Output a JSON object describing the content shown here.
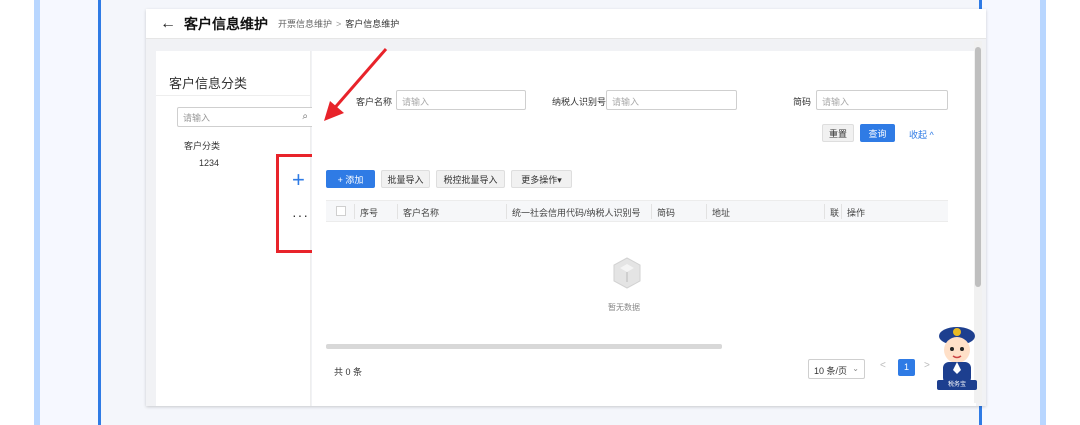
{
  "header": {
    "back_icon": "left-arrow-icon",
    "title": "客户信息维护",
    "breadcrumb": [
      "开票信息维护",
      "客户信息维护"
    ],
    "breadcrumb_sep": ">"
  },
  "left": {
    "title": "客户信息分类",
    "search_placeholder": "请输入",
    "tree": {
      "root": "客户分类",
      "child": "1234"
    },
    "annotation": {
      "plus": "+",
      "more": "···"
    }
  },
  "filters": {
    "customer_name_label": "客户名称",
    "customer_name_placeholder": "请输入",
    "tax_id_label": "纳税人识别号",
    "tax_id_placeholder": "请输入",
    "short_label": "简码",
    "short_placeholder": "请输入",
    "reset": "重置",
    "query": "查询",
    "collapse": "收起 ^"
  },
  "toolbar": {
    "add": "+ 添加",
    "batch_import": "批量导入",
    "tax_import": "税控批量导入",
    "more_actions": "更多操作▾"
  },
  "table": {
    "columns": [
      "序号",
      "客户名称",
      "统一社会信用代码/纳税人识别号",
      "简码",
      "地址",
      "联系",
      "操作"
    ],
    "empty_text": "暂无数据"
  },
  "pagination": {
    "total": "共 0 条",
    "page_size": "10 条/页",
    "prev": "<",
    "current": "1",
    "next": ">"
  },
  "mascot": {
    "label": "税务宝"
  },
  "colors": {
    "accent": "#2f7be5",
    "annotation_red": "#e8232a"
  }
}
